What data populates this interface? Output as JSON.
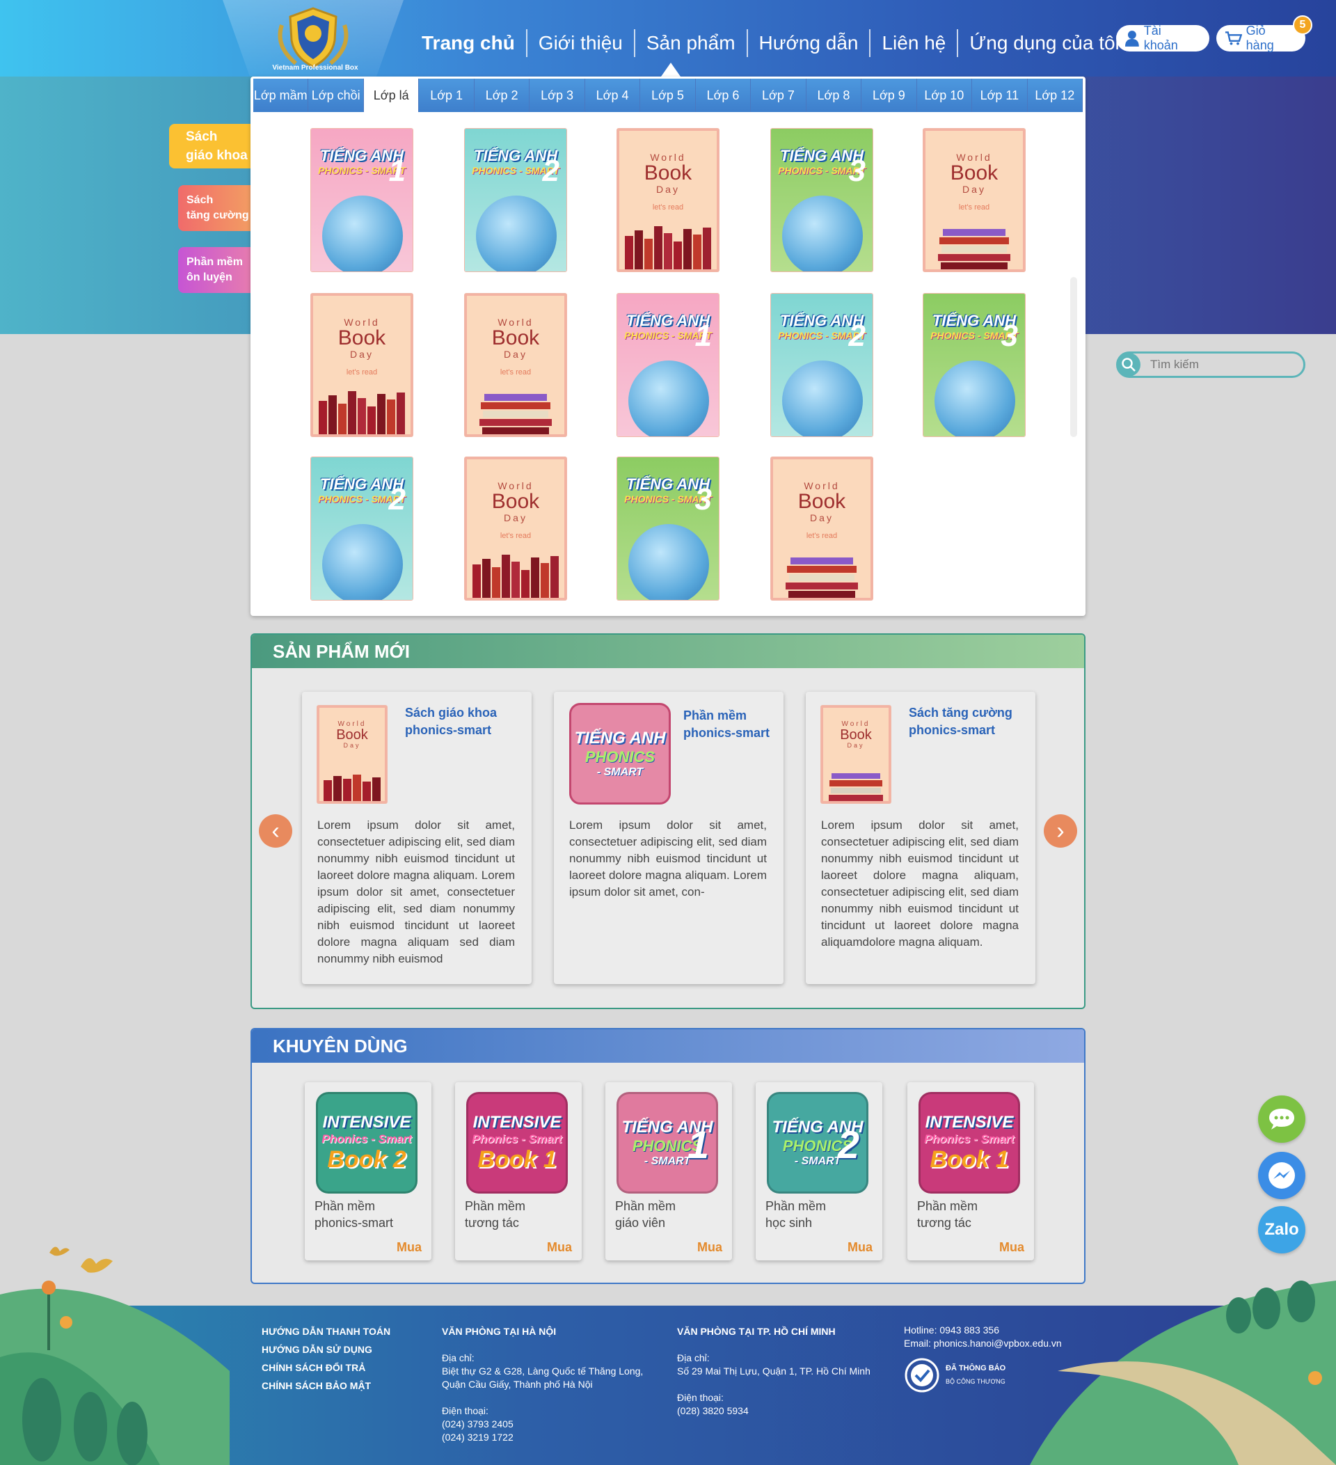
{
  "header": {
    "logo_text": "Vietnam Professional Box",
    "nav": [
      "Trang chủ",
      "Giới thiệu",
      "Sản phẩm",
      "Hướng dẫn",
      "Liên hệ",
      "Ứng dụng của tôi"
    ],
    "account_label": "Tài khoản",
    "cart_label": "Giỏ hàng",
    "cart_count": "5"
  },
  "side_tabs": {
    "textbook": [
      "Sách",
      "giáo khoa"
    ],
    "supplement": [
      "Sách",
      "tăng cường"
    ],
    "software": [
      "Phần mềm",
      "ôn luyện"
    ]
  },
  "grade_tabs": [
    "Lớp mầm",
    "Lớp chồi",
    "Lớp lá",
    "Lớp 1",
    "Lớp 2",
    "Lớp 3",
    "Lớp 4",
    "Lớp 5",
    "Lớp 6",
    "Lớp 7",
    "Lớp 8",
    "Lớp 9",
    "Lớp 10",
    "Lớp 11",
    "Lớp 12"
  ],
  "active_grade": "Lớp lá",
  "books": [
    {
      "type": "tieng",
      "num": "1",
      "theme": "pink"
    },
    {
      "type": "tieng",
      "num": "2",
      "theme": "teal"
    },
    {
      "type": "wbd",
      "theme": "red"
    },
    {
      "type": "tieng",
      "num": "3",
      "theme": "green"
    },
    {
      "type": "wbd",
      "theme": "books"
    },
    {
      "type": "wbd",
      "theme": "red"
    },
    {
      "type": "wbd",
      "theme": "books"
    },
    {
      "type": "tieng",
      "num": "1",
      "theme": "pink"
    },
    {
      "type": "tieng",
      "num": "2",
      "theme": "teal"
    },
    {
      "type": "tieng",
      "num": "3",
      "theme": "green"
    },
    {
      "type": "tieng",
      "num": "2",
      "theme": "teal"
    },
    {
      "type": "wbd",
      "theme": "red"
    },
    {
      "type": "tieng",
      "num": "3",
      "theme": "green"
    },
    {
      "type": "wbd",
      "theme": "books"
    }
  ],
  "cover_text": {
    "tieng_title": "TIẾNG ANH",
    "tieng_sub": "PHONICS - SMART",
    "wbd_world": "World",
    "wbd_book": "Book",
    "wbd_day": "Day",
    "wbd_read": "let's read"
  },
  "search": {
    "placeholder": "Tìm kiếm"
  },
  "new_products": {
    "title": "SẢN PHẨM MỚI",
    "cards": [
      {
        "title": "Sách giáo khoa phonics-smart",
        "body": "Lorem ipsum dolor sit amet, consectetuer adipiscing elit, sed diam nonummy nibh euismod tincidunt ut laoreet dolore magna aliquam. Lorem ipsum dolor sit amet, consectetuer adipiscing elit, sed diam nonummy nibh euismod tincidunt ut laoreet dolore magna aliquam sed diam nonummy nibh euismod"
      },
      {
        "title": "Phần mềm phonics-smart",
        "body": "Lorem ipsum dolor sit amet, consectetuer adipiscing elit, sed diam nonummy nibh euismod tincidunt ut laoreet dolore magna aliquam. Lorem ipsum dolor sit amet, con-"
      },
      {
        "title": "Sách tăng cường phonics-smart",
        "body": "Lorem ipsum dolor sit amet, consectetuer adipiscing elit, sed diam nonummy nibh euismod tincidunt ut laoreet dolore magna aliquam, consectetuer adipiscing elit, sed diam nonummy nibh euismod tincidunt ut tincidunt ut laoreet dolore magna aliquamdolore magna aliquam."
      }
    ]
  },
  "recommended": {
    "title": "KHUYÊN DÙNG",
    "buy_label": "Mua",
    "items": [
      {
        "label1": "Phần mềm",
        "label2": "phonics-smart",
        "icon": "intensive",
        "book": "Book 2",
        "color": "#3aa48a"
      },
      {
        "label1": "Phần mềm",
        "label2": "tương tác",
        "icon": "intensive",
        "book": "Book 1",
        "color": "#c93a7a"
      },
      {
        "label1": "Phần mềm",
        "label2": "giáo viên",
        "icon": "tieng",
        "num": "1",
        "color": "#e07a9e"
      },
      {
        "label1": "Phần mềm",
        "label2": "học sinh",
        "icon": "tieng",
        "num": "2",
        "color": "#46a8a0"
      },
      {
        "label1": "Phần mềm",
        "label2": "tương tác",
        "icon": "intensive",
        "book": "Book 1",
        "color": "#c93a7a"
      }
    ],
    "intensive_l1": "INTENSIVE",
    "intensive_l2": "Phonics - Smart",
    "tieng_l1": "TIẾNG ANH",
    "tieng_l2": "PHONICS",
    "tieng_l3": "- SMART"
  },
  "floating": {
    "zalo": "Zalo"
  },
  "footer": {
    "links": [
      "HƯỚNG DẪN THANH TOÁN",
      "HƯỚNG DẪN SỬ DỤNG",
      "CHÍNH SÁCH ĐỔI TRẢ",
      "CHÍNH SÁCH BẢO MẬT"
    ],
    "hanoi": {
      "title": "VĂN PHÒNG TẠI HÀ NỘI",
      "addr_label": "Địa chỉ:",
      "addr1": "Biệt thự G2 & G28, Làng Quốc tế Thăng Long,",
      "addr2": "Quận Cầu Giấy, Thành phố Hà Nội",
      "phone_label": "Điện thoại:",
      "phone1": "(024) 3793 2405",
      "phone2": "(024) 3219 1722"
    },
    "hcm": {
      "title": "VĂN PHÒNG TẠI TP. HỒ CHÍ MINH",
      "addr_label": "Địa chỉ:",
      "addr1": "Số 29 Mai Thị Lựu, Quận 1, TP. Hồ Chí Minh",
      "phone_label": "Điện thoại:",
      "phone1": "(028) 3820 5934"
    },
    "hotline": "Hotline: 0943 883 356",
    "email": "Email: phonics.hanoi@vpbox.edu.vn",
    "cert1": "ĐÃ THÔNG BÁO",
    "cert2": "BỘ CÔNG THƯƠNG"
  }
}
